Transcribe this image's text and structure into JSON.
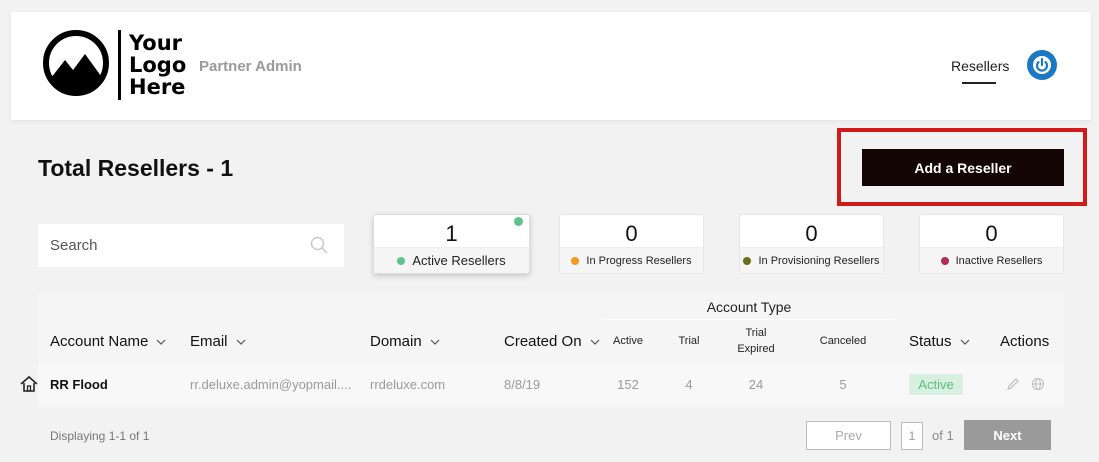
{
  "header": {
    "logo_lines": [
      "Your",
      "Logo",
      "Here"
    ],
    "subtitle": "Partner Admin",
    "nav_item": "Resellers",
    "power_icon": "power-icon"
  },
  "main": {
    "title": "Total Resellers - 1",
    "add_button": "Add a Reseller",
    "search_placeholder": "Search"
  },
  "summary_cards": [
    {
      "count": "1",
      "label": "Active Resellers",
      "dot_color": "#5cc48a"
    },
    {
      "count": "0",
      "label": "In Progress Resellers",
      "dot_color": "#f39a1c"
    },
    {
      "count": "0",
      "label": "In Provisioning Resellers",
      "dot_color": "#6b6b1a"
    },
    {
      "count": "0",
      "label": "Inactive Resellers",
      "dot_color": "#b02a5a"
    }
  ],
  "table": {
    "group_header": "Account Type",
    "columns": {
      "account_name": "Account Name",
      "email": "Email",
      "domain": "Domain",
      "created_on": "Created On",
      "active": "Active",
      "trial": "Trial",
      "trial_expired_1": "Trial",
      "trial_expired_2": "Expired",
      "canceled": "Canceled",
      "status": "Status",
      "actions": "Actions"
    },
    "rows": [
      {
        "account_name": "RR Flood",
        "email": "rr.deluxe.admin@yopmail....",
        "domain": "rrdeluxe.com",
        "created_on": "8/8/19",
        "active": "152",
        "trial": "4",
        "trial_expired": "24",
        "canceled": "5",
        "status": "Active"
      }
    ]
  },
  "pagination": {
    "summary": "Displaying 1-1 of 1",
    "prev": "Prev",
    "page": "1",
    "of": "of 1",
    "next": "Next"
  },
  "colors": {
    "highlight": "#d11a1a",
    "primary_button": "#140505",
    "power_icon": "#1b79c3",
    "status_active": "#5cba7d"
  }
}
